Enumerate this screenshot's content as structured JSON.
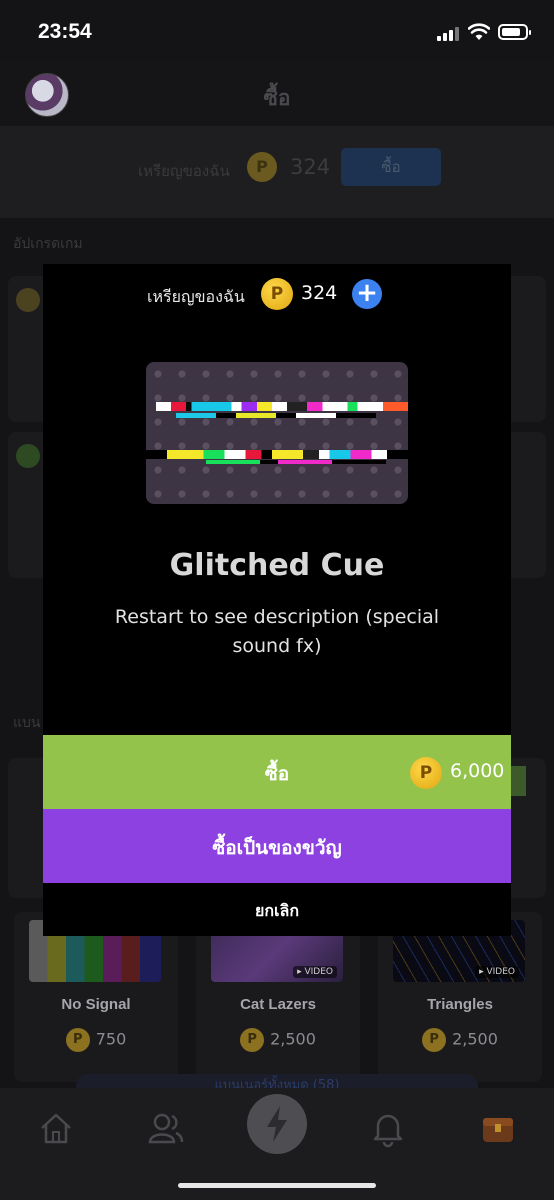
{
  "status_bar": {
    "time": "23:54"
  },
  "header": {
    "title": "ซื้อ"
  },
  "coins_bar": {
    "label": "เหรียญของฉัน",
    "coin_symbol": "P",
    "amount": "324",
    "buy_label": "ซื้อ"
  },
  "sections": {
    "upgrade_title": "อัปเกรดเกม",
    "banners_title": "แบน"
  },
  "shop_items": [
    {
      "name": "No Signal",
      "price": "750"
    },
    {
      "name": "Cat Lazers",
      "price": "2,500",
      "tag": "VIDEO"
    },
    {
      "name": "Triangles",
      "price": "2,500",
      "tag": "VIDEO"
    }
  ],
  "view_all": {
    "label": "แบนเนอร์ทั้งหมด (58)"
  },
  "modal": {
    "coins_label": "เหรียญของฉัน",
    "coin_symbol": "P",
    "coins_amount": "324",
    "add_symbol": "+",
    "item_title": "Glitched Cue",
    "item_description": "Restart to see description (special sound fx)",
    "buy_label": "ซื้อ",
    "buy_price": "6,000",
    "gift_label": "ซื้อเป็นของขวัญ",
    "cancel_label": "ยกเลิก"
  },
  "colors": {
    "buy_green": "#93c34b",
    "gift_purple": "#8d41e0",
    "add_blue": "#3b82f0",
    "coin_gold": "#f2c12e"
  },
  "icons": {
    "tabbar": [
      "home-icon",
      "friends-icon",
      "lightning-icon",
      "bell-icon",
      "treasure-chest-icon"
    ]
  }
}
